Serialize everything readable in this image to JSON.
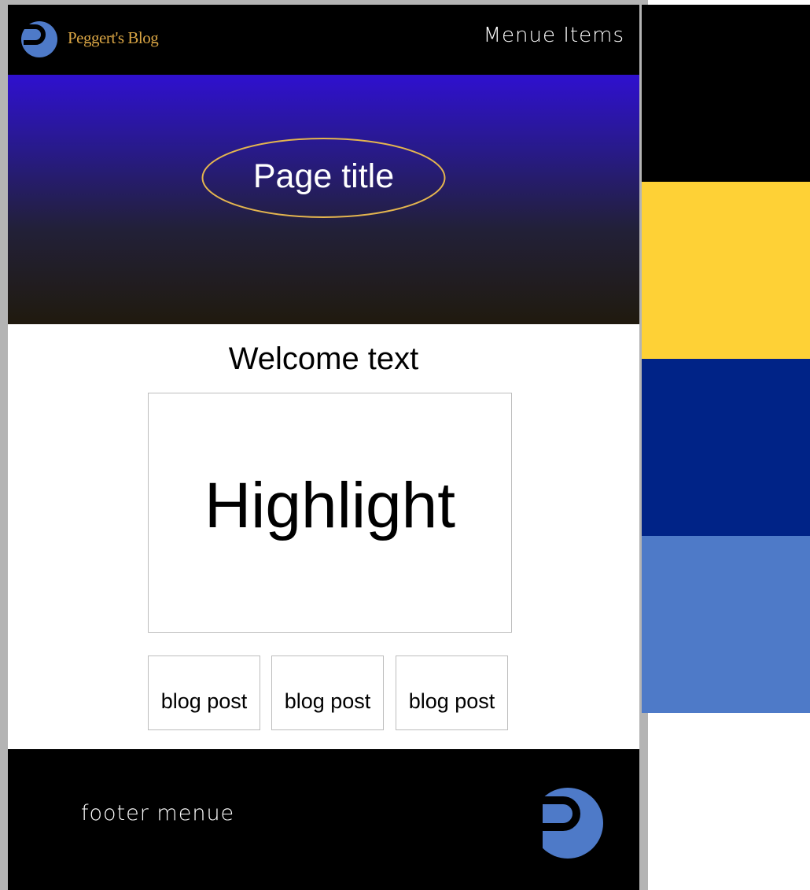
{
  "header": {
    "brand_name": "Peggert's Blog",
    "menu_label": "Menue Items",
    "logo_icon": "blog-logo-icon"
  },
  "hero": {
    "page_title": "Page title"
  },
  "content": {
    "welcome_text": "Welcome text",
    "highlight_label": "Highlight",
    "posts": [
      {
        "label": "blog post"
      },
      {
        "label": "blog post"
      },
      {
        "label": "blog post"
      }
    ]
  },
  "footer": {
    "menu_label": "footer menue",
    "logo_icon": "footer-logo-icon"
  },
  "colors": {
    "brand_text": "#d8a444",
    "accent_gold": "#fed136",
    "navy": "#002387",
    "logo_blue": "#4e7ac8",
    "black": "#000000"
  },
  "palette": [
    {
      "color": "#000000"
    },
    {
      "color": "#fed136"
    },
    {
      "color": "#002387"
    },
    {
      "color": "#4e7ac8"
    }
  ]
}
